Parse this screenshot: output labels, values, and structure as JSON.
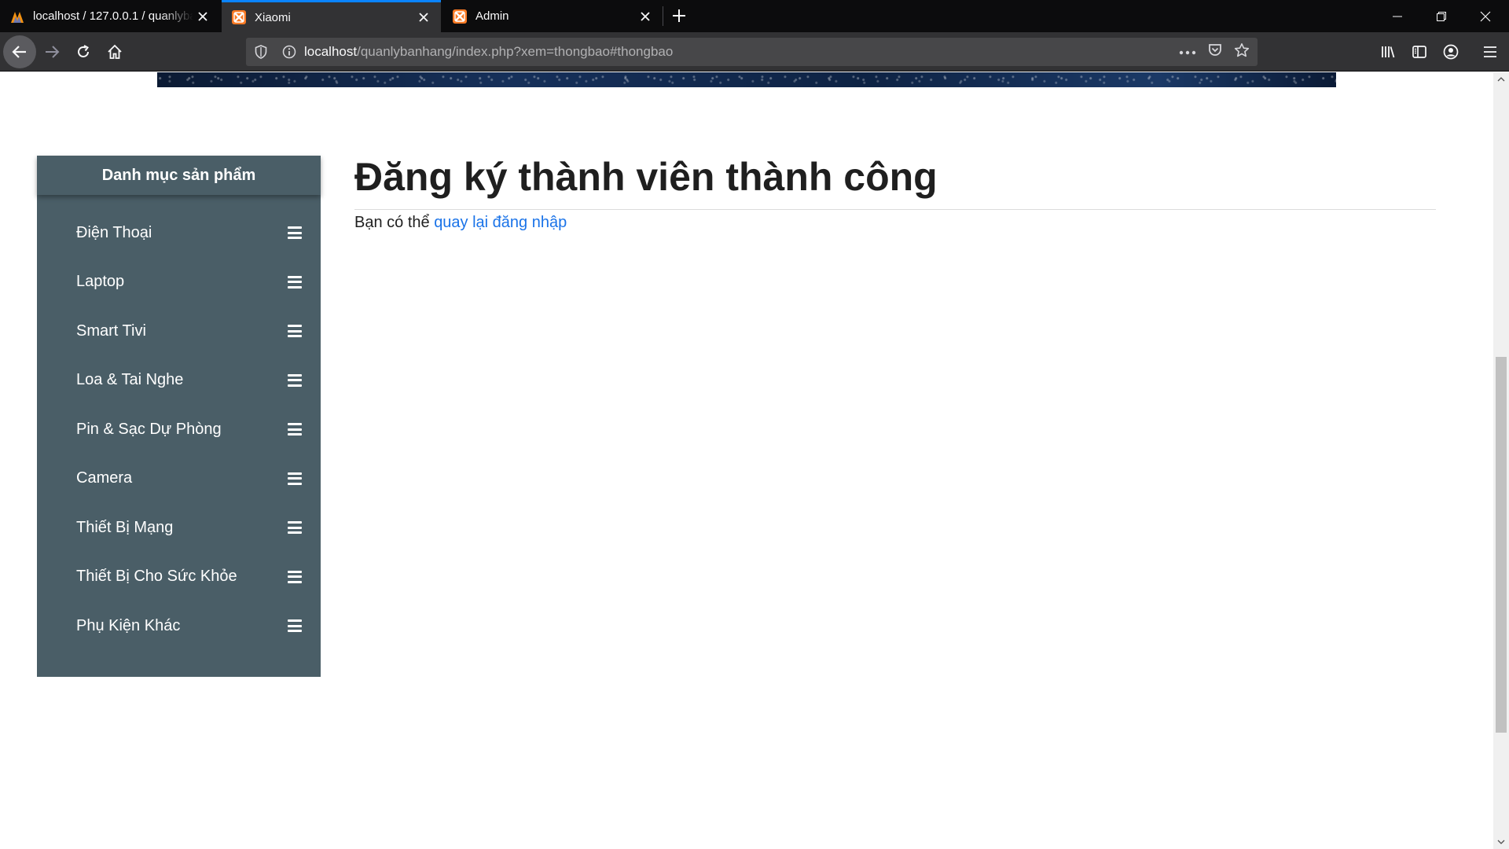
{
  "browser": {
    "tabs": [
      {
        "title": "localhost / 127.0.0.1 / quanlyba",
        "favicon": "phpmyadmin-icon",
        "active": false
      },
      {
        "title": "Xiaomi",
        "favicon": "xampp-icon",
        "active": true
      },
      {
        "title": "Admin",
        "favicon": "xampp-icon",
        "active": false
      }
    ],
    "url": {
      "host": "localhost",
      "path": "/quanlybanhang/index.php?xem=thongbao#thongbao"
    },
    "accent_color": "#0a84ff"
  },
  "sidebar": {
    "header": "Danh mục sản phẩm",
    "items": [
      {
        "label": "Điện Thoại"
      },
      {
        "label": "Laptop"
      },
      {
        "label": "Smart Tivi"
      },
      {
        "label": "Loa & Tai Nghe"
      },
      {
        "label": "Pin & Sạc Dự Phòng"
      },
      {
        "label": "Camera"
      },
      {
        "label": "Thiết Bị Mạng"
      },
      {
        "label": "Thiết Bị Cho Sức Khỏe"
      },
      {
        "label": "Phụ Kiện Khác"
      }
    ],
    "background_color": "#4a5e67"
  },
  "main": {
    "title": "Đăng ký thành viên thành công",
    "message_prefix": "Bạn có thể ",
    "message_link": "quay lại đăng nhập",
    "link_color": "#1a73e8"
  }
}
